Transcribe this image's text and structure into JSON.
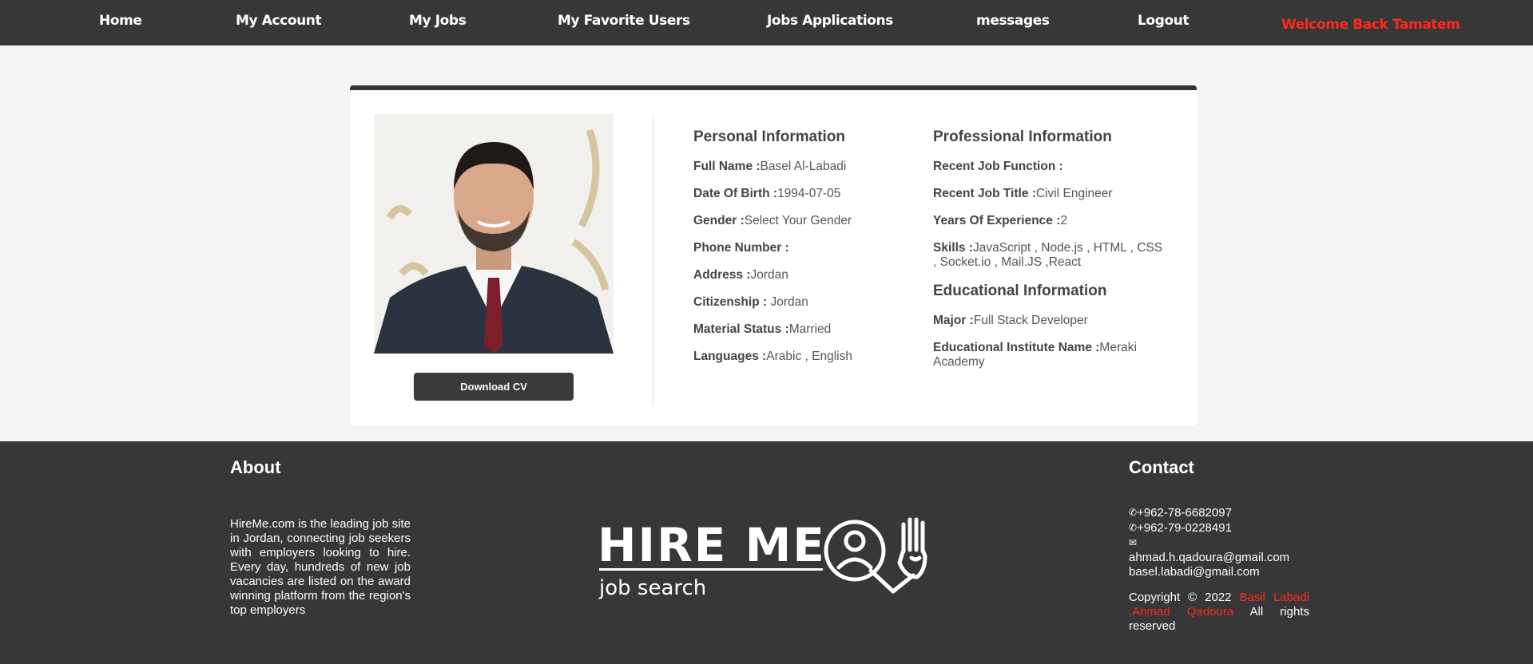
{
  "nav": {
    "home": "Home",
    "my_account": "My Account",
    "my_jobs": "My Jobs",
    "my_favorite_users": "My Favorite Users",
    "jobs_applications": "Jobs Applications",
    "messages": "messages",
    "logout": "Logout",
    "welcome": "Welcome Back Tamatem"
  },
  "profile": {
    "download_cv": "Download CV",
    "personal": {
      "title": "Personal Information",
      "full_name_label": "Full Name :",
      "full_name": "Basel Al-Labadi",
      "dob_label": "Date Of Birth :",
      "dob": "1994-07-05",
      "gender_label": "Gender :",
      "gender": "Select Your Gender",
      "phone_label": "Phone Number :",
      "phone": "",
      "address_label": "Address :",
      "address": "Jordan",
      "citizenship_label": "Citizenship :",
      "citizenship": " Jordan",
      "marital_label": "Material Status :",
      "marital": "Married",
      "languages_label": "Languages :",
      "languages": "Arabic , English"
    },
    "professional": {
      "title": "Professional Information",
      "job_function_label": "Recent Job Function :",
      "job_function": "",
      "job_title_label": "Recent Job Title :",
      "job_title": "Civil Engineer",
      "experience_label": "Years Of Experience :",
      "experience": "2",
      "skills_label": "Skills :",
      "skills": "JavaScript , Node.js , HTML , CSS , Socket.io , Mail.JS ,React"
    },
    "educational": {
      "title": "Educational Information",
      "major_label": "Major :",
      "major": "Full Stack Developer",
      "institute_label": "Educational Institute Name :",
      "institute": "Meraki Academy"
    }
  },
  "footer": {
    "about_title": "About",
    "about_text": "HireMe.com is the leading job site in Jordan, connecting job seekers with employers looking to hire. Every day, hundreds of new job vacancies are listed on the award winning platform from the region's top employers",
    "logo_main": "HIRE ME",
    "logo_sub": "job search",
    "contact_title": "Contact",
    "phone1": "+962-78-6682097",
    "phone2": "+962-79-0228491",
    "email1": "ahmad.h.qadoura@gmail.com",
    "email2": "basel.labadi@gmail.com",
    "copyright_prefix": "Copyright © 2022 ",
    "copyright_names": "Basil Labadi ,Ahmad Qadoura",
    "copyright_suffix": " All rights reserved"
  },
  "icons": {
    "phone": "phone-icon",
    "envelope": "envelope-icon"
  },
  "colors": {
    "navbar": "#373739",
    "accent_red": "#ff2a1a",
    "page_bg": "#f4f4f4",
    "footer": "#373739"
  }
}
